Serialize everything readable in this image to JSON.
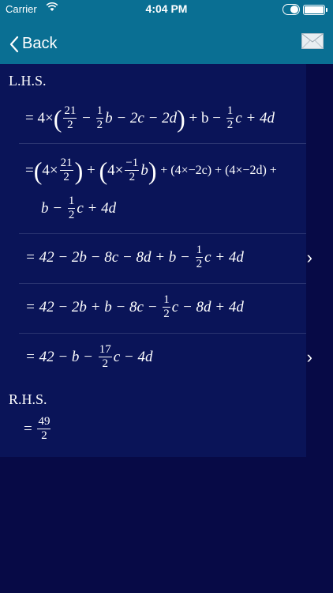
{
  "status": {
    "carrier": "Carrier",
    "time": "4:04 PM"
  },
  "nav": {
    "back_label": "Back"
  },
  "lhs": {
    "title": "L.H.S.",
    "rows": [
      {
        "id": 1,
        "has_chevron": false
      },
      {
        "id": 2,
        "has_chevron": false
      },
      {
        "id": 3,
        "has_chevron": true
      },
      {
        "id": 4,
        "has_chevron": false
      },
      {
        "id": 5,
        "has_chevron": true
      }
    ]
  },
  "rhs": {
    "title": "R.H.S.",
    "num": "49",
    "den": "2"
  },
  "math": {
    "eq": "=",
    "four": "4×",
    "n21": "21",
    "d2": "2",
    "n1": "1",
    "nneg1": "−1",
    "n17": "17",
    "r1_tail1": "b − 2c − 2d",
    "r1_tail2": "+ b −",
    "r1_tail3": "c + 4d",
    "r2_a": "+",
    "r2_b": "b",
    "r2_c": "+ (4×−2c) + (4×−2d) +",
    "r2_l2a": "b −",
    "r2_l2b": "c + 4d",
    "r3_a": "= 42 − 2b − 8c − 8d + b −",
    "r3_b": "c + 4d",
    "r4_a": "= 42 − 2b + b − 8c −",
    "r4_b": "c − 8d + 4d",
    "r5_a": "= 42 − b −",
    "r5_b": "c − 4d"
  }
}
